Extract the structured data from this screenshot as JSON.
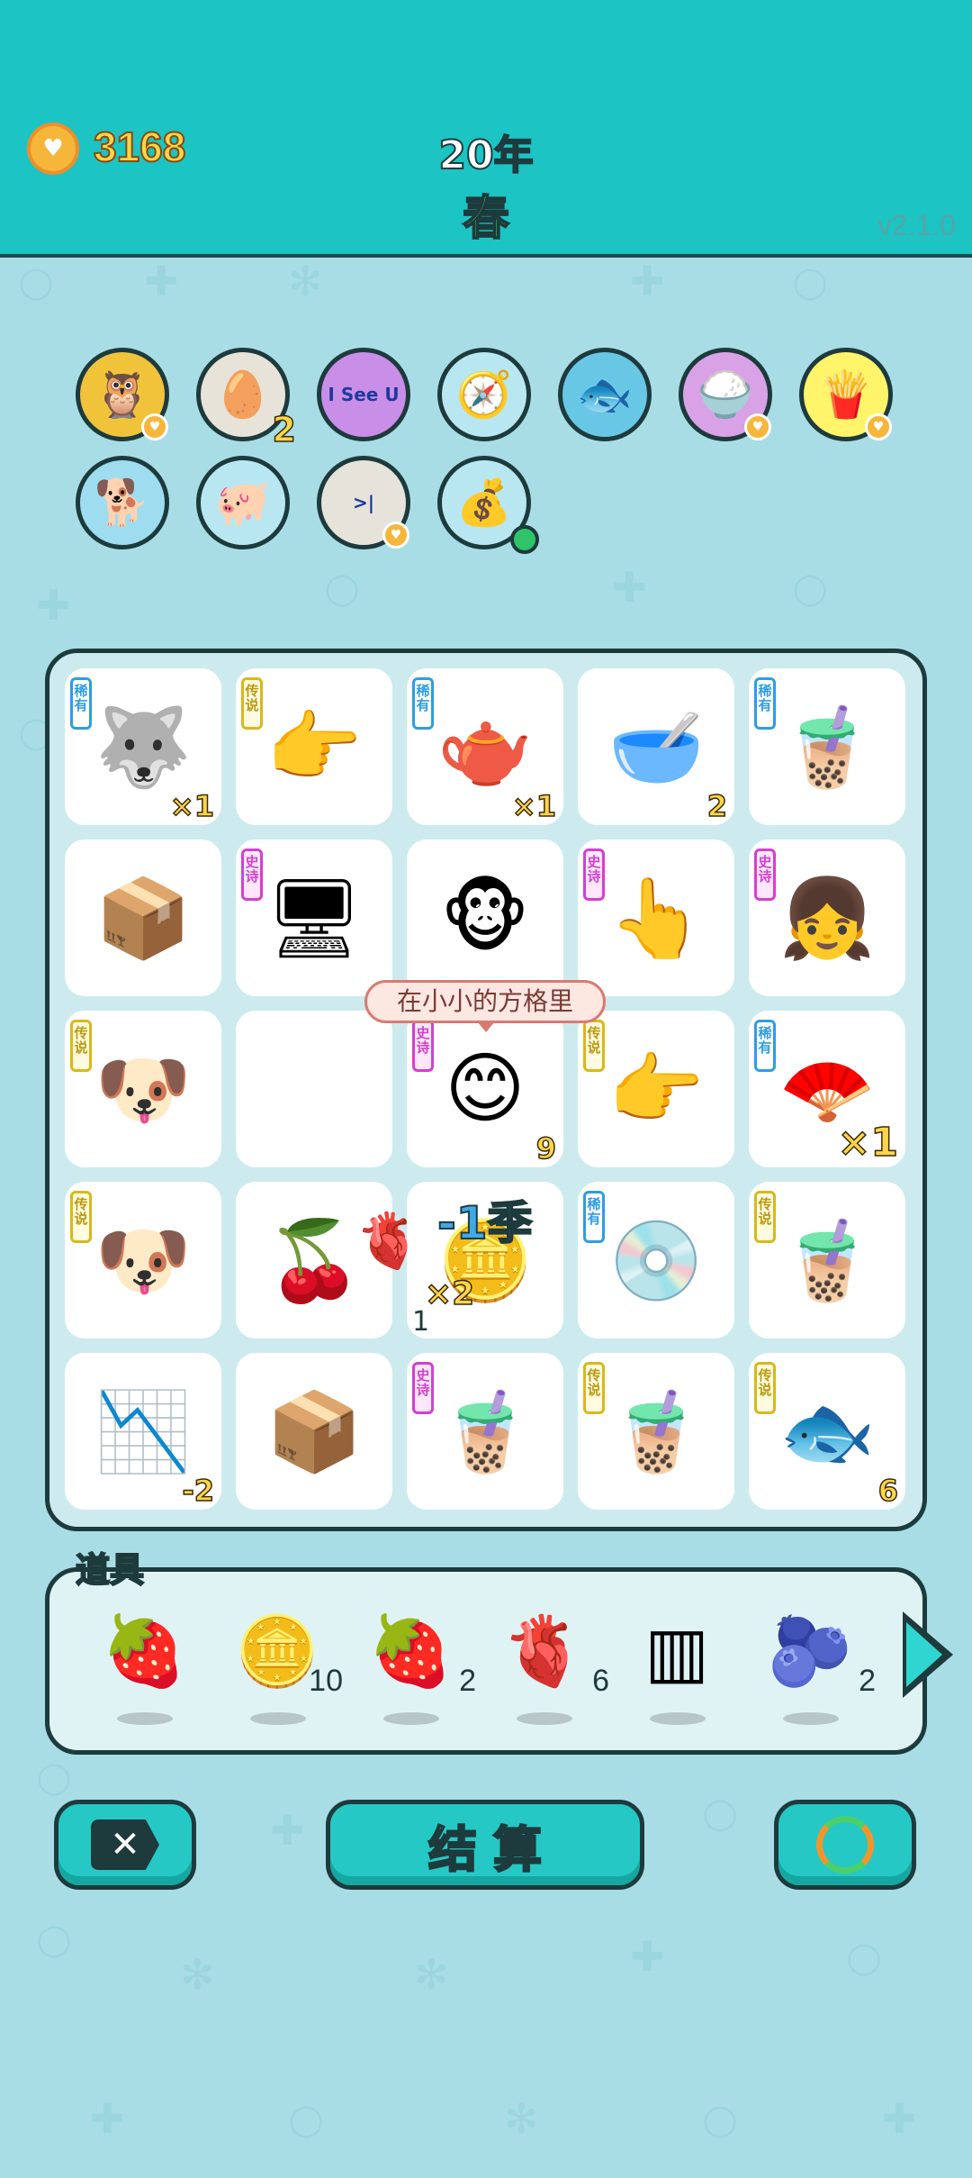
{
  "header": {
    "coins": "3168",
    "year": "20年",
    "season": "春",
    "version": "v2.1.0"
  },
  "owned": [
    {
      "name": "owl-glasses-icon",
      "emoji": "🦉",
      "bg": "#f1c33b",
      "heart": true
    },
    {
      "name": "egg-tray-icon",
      "emoji": "🥚",
      "bg": "#e8e3d8",
      "count": "2"
    },
    {
      "name": "i-see-u-sign-icon",
      "text": "I See U",
      "bg": "#c98ee8"
    },
    {
      "name": "compass-icon",
      "emoji": "🧭",
      "bg": "#b8e7f2"
    },
    {
      "name": "fishbowl-icon",
      "emoji": "🐟",
      "bg": "#69c7e6"
    },
    {
      "name": "rice-bowl-icon",
      "emoji": "🍚",
      "bg": "#d9a2e6",
      "heart": true
    },
    {
      "name": "french-fries-icon",
      "emoji": "🍟",
      "bg": "#fff46a",
      "heart": true
    },
    {
      "name": "dog-gold-chain-icon",
      "emoji": "🐕",
      "bg": "#9edcf0"
    },
    {
      "name": "piggy-bank-icon",
      "emoji": "🐖",
      "bg": "#b8e7f2"
    },
    {
      "name": "skip-next-icon",
      "text": ">|",
      "bg": "#e6e3da",
      "heart": true
    },
    {
      "name": "money-bag-icon",
      "emoji": "💰",
      "bg": "#b8e7f2",
      "dot": true
    }
  ],
  "board": [
    {
      "name": "husky-dog",
      "emoji": "🐺",
      "tag": "稀有",
      "rarity": "rare",
      "count": "×1"
    },
    {
      "name": "pointing-hand-yellow",
      "emoji": "👉",
      "tag": "传说",
      "rarity": "legend"
    },
    {
      "name": "teapot",
      "emoji": "🫖",
      "tag": "稀有",
      "rarity": "rare",
      "count": "×1"
    },
    {
      "name": "soup-bowl",
      "emoji": "🥣",
      "count": "2"
    },
    {
      "name": "bubble-tea-small",
      "emoji": "🧋",
      "tag": "稀有",
      "rarity": "rare"
    },
    {
      "name": "cardboard-box",
      "emoji": "📦"
    },
    {
      "name": "graphics-card",
      "emoji": "🖥",
      "tag": "史诗",
      "rarity": "epic"
    },
    {
      "name": "monkey-grandpa",
      "emoji": "🐵"
    },
    {
      "name": "pointing-hand-gray",
      "emoji": "👆",
      "tag": "史诗",
      "rarity": "epic"
    },
    {
      "name": "braided-girl",
      "emoji": "👧",
      "tag": "史诗",
      "rarity": "epic"
    },
    {
      "name": "husky-king-1",
      "emoji": "🐶",
      "tag": "传说",
      "rarity": "legend"
    },
    {
      "name": "empty-cell",
      "emoji": ""
    },
    {
      "name": "smiley-face",
      "emoji": "😊",
      "tag": "史诗",
      "rarity": "epic",
      "count": "9"
    },
    {
      "name": "pointing-hand-yellow-2",
      "emoji": "👉",
      "tag": "传说",
      "rarity": "legend"
    },
    {
      "name": "folding-fan",
      "emoji": "🪭",
      "tag": "稀有",
      "rarity": "rare",
      "count": "×1",
      "big": true
    },
    {
      "name": "husky-king-2",
      "emoji": "🐶",
      "tag": "传说",
      "rarity": "legend"
    },
    {
      "name": "cherry",
      "emoji": "🍒"
    },
    {
      "name": "gold-bars",
      "emoji": "🪙"
    },
    {
      "name": "cd-disc",
      "emoji": "💿",
      "tag": "稀有",
      "rarity": "rare"
    },
    {
      "name": "bubble-tea-large",
      "emoji": "🧋",
      "tag": "传说",
      "rarity": "legend"
    },
    {
      "name": "stock-down-chart",
      "emoji": "📉",
      "count": "-2"
    },
    {
      "name": "cardboard-box-2",
      "emoji": "📦"
    },
    {
      "name": "bubble-tea-tall",
      "emoji": "🧋",
      "tag": "史诗",
      "rarity": "epic"
    },
    {
      "name": "bubble-tea-dome",
      "emoji": "🧋",
      "tag": "传说",
      "rarity": "legend"
    },
    {
      "name": "koi-fish",
      "emoji": "🐟",
      "tag": "传说",
      "rarity": "legend",
      "count": "6"
    }
  ],
  "effects": {
    "minus_season": "-1季",
    "multiplier": "×2",
    "small_one": "1",
    "tooltip": "在小小的方格里"
  },
  "tools": {
    "label": "道具",
    "items": [
      {
        "name": "lychee-icon",
        "emoji": "🍓",
        "count": ""
      },
      {
        "name": "coin-dollar-icon",
        "emoji": "🪙",
        "count": "10"
      },
      {
        "name": "strawberry-icon",
        "emoji": "🍓",
        "count": "2"
      },
      {
        "name": "liver-icon",
        "emoji": "🫀",
        "count": "6"
      },
      {
        "name": "three-slots-icon",
        "emoji": "▥",
        "count": ""
      },
      {
        "name": "blueberry-icon",
        "emoji": "🫐",
        "count": "2"
      }
    ]
  },
  "buttons": {
    "settle": "结算"
  }
}
